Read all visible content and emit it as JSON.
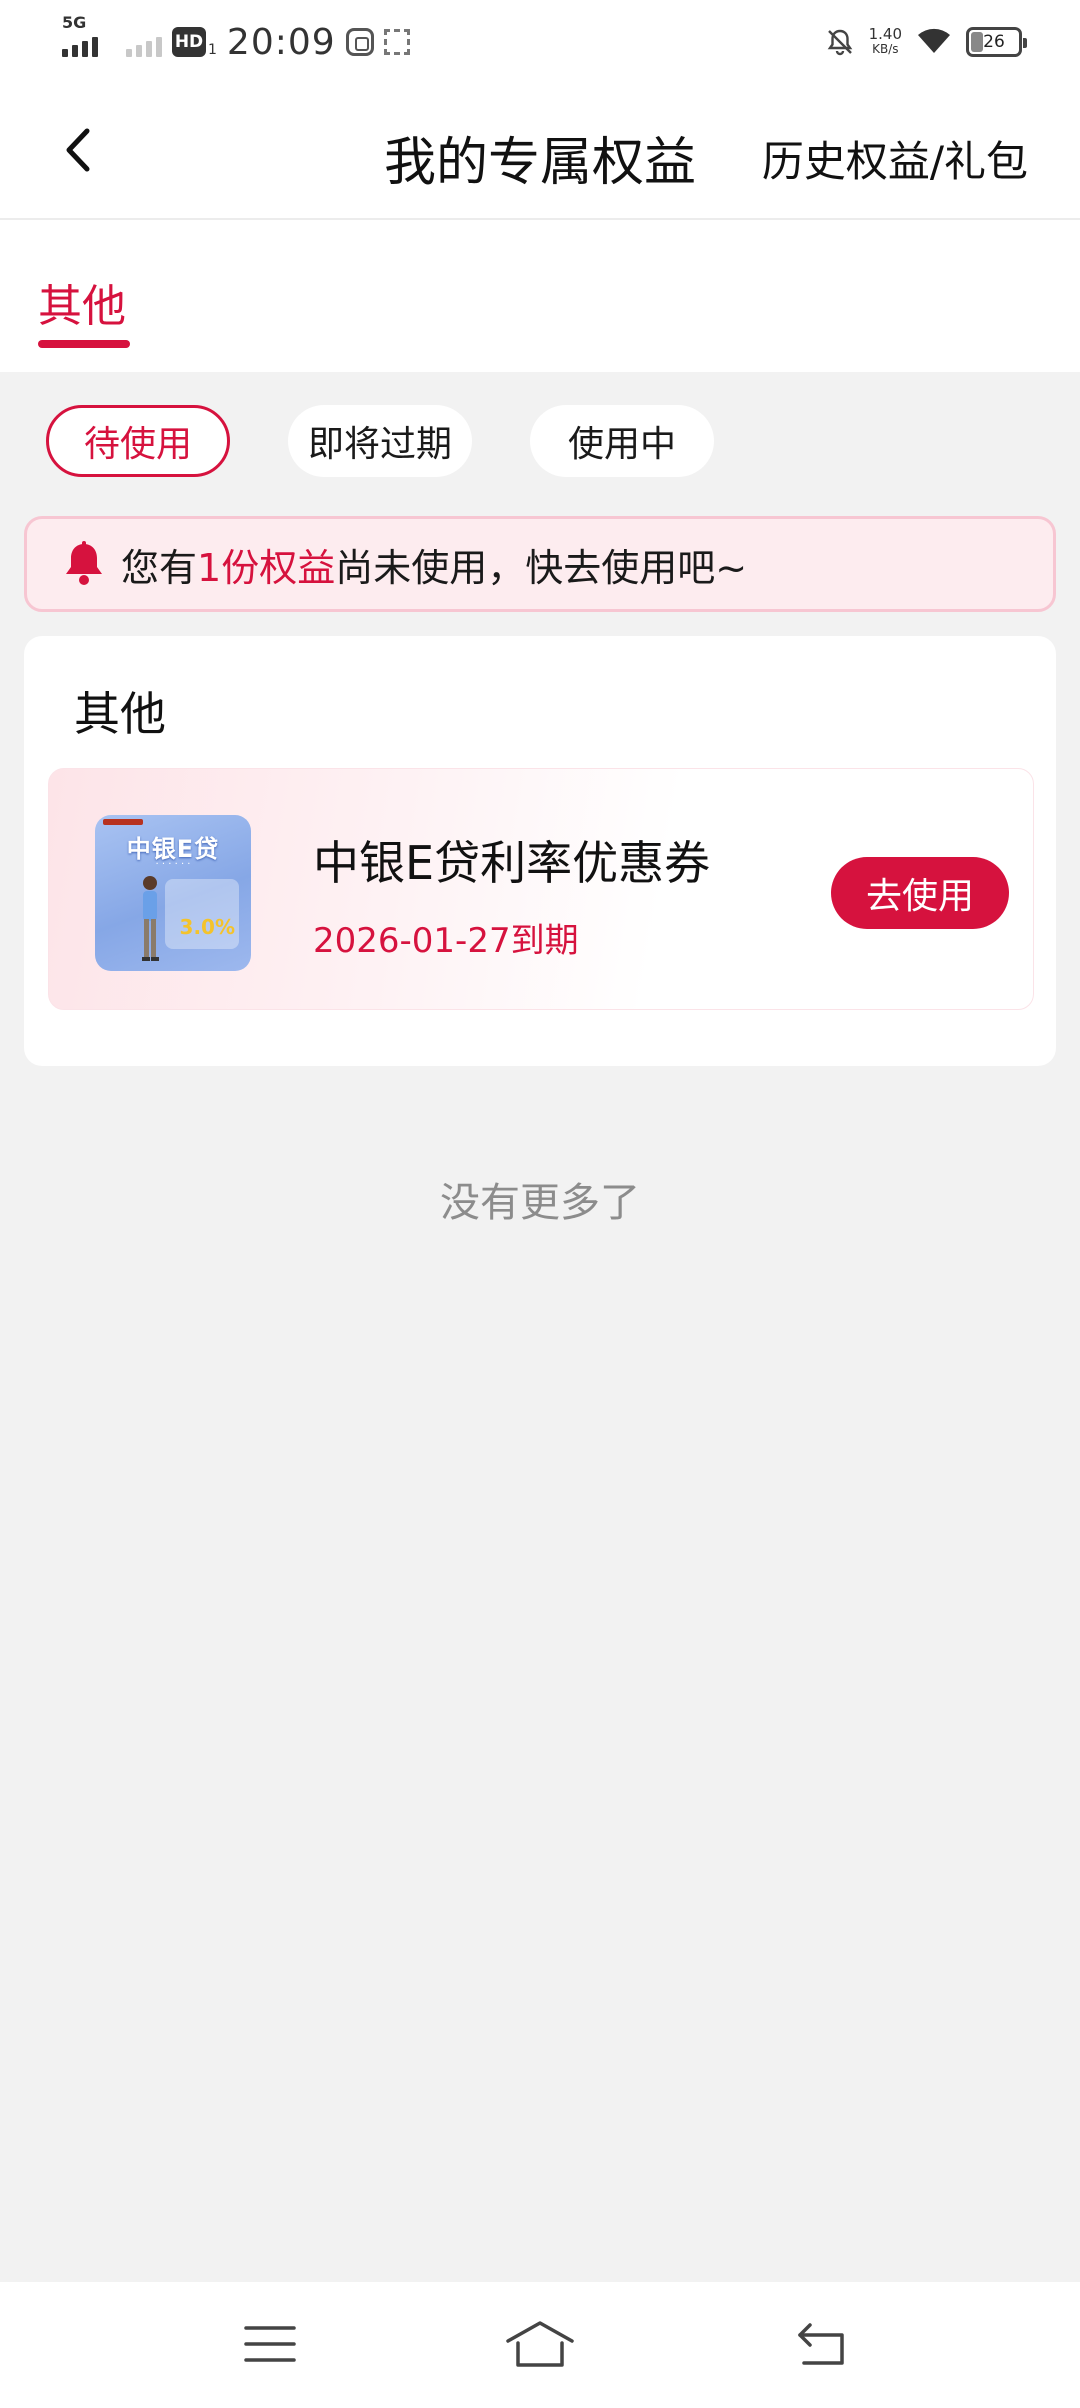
{
  "status_bar": {
    "network_label": "5G",
    "hd_label": "HD",
    "hd_sub": "1",
    "time": "20:09",
    "net_speed_value": "1.40",
    "net_speed_unit": "KB/s",
    "battery_level": "26"
  },
  "header": {
    "title": "我的专属权益",
    "history_link": "历史权益/礼包",
    "back_icon": "chevron-left-icon"
  },
  "tabs": [
    {
      "label": "其他",
      "active": true
    }
  ],
  "filters": [
    {
      "label": "待使用",
      "active": true
    },
    {
      "label": "即将过期",
      "active": false
    },
    {
      "label": "使用中",
      "active": false
    }
  ],
  "notice": {
    "prefix": "您有",
    "highlight": "1份权益",
    "suffix": "尚未使用，快去使用吧~",
    "icon": "bell-icon"
  },
  "section": {
    "title": "其他",
    "items": [
      {
        "name": "中银E贷利率优惠券",
        "expiry": "2026-01-27到期",
        "action_label": "去使用",
        "thumbnail": {
          "title": "中银E贷",
          "rate": "3.0%"
        }
      }
    ]
  },
  "footer_text": "没有更多了",
  "system_nav": {
    "menu_icon": "menu-icon",
    "home_icon": "home-icon",
    "back_icon": "back-icon"
  },
  "colors": {
    "accent": "#d6123e",
    "background": "#f2f2f2",
    "notice_bg": "#fdecef"
  }
}
